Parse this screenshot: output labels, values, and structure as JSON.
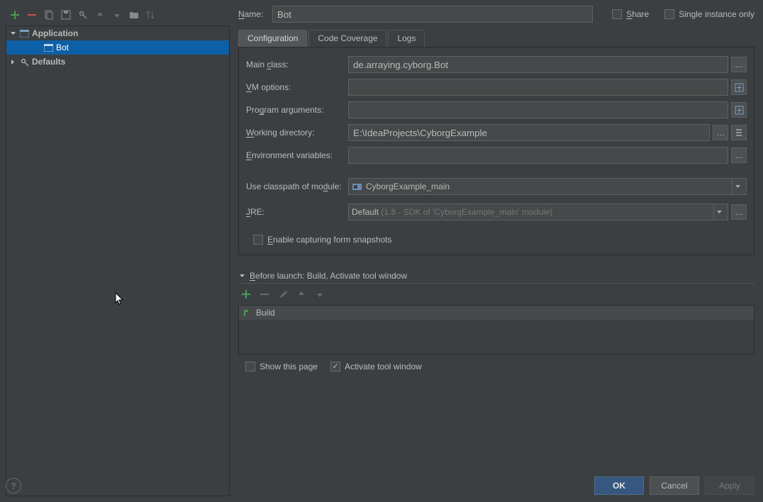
{
  "header": {
    "name_label": "Name:",
    "name_value": "Bot",
    "share_label": "Share",
    "single_instance_label": "Single instance only"
  },
  "toolbar_icons": [
    "add",
    "remove",
    "copy",
    "save",
    "settings",
    "up",
    "down",
    "folder",
    "sort"
  ],
  "tree": {
    "root": "Application",
    "child": "Bot",
    "defaults": "Defaults"
  },
  "tabs": {
    "active": "Configuration",
    "tab1": "Configuration",
    "tab2": "Code Coverage",
    "tab3": "Logs"
  },
  "form": {
    "main_class_label": "Main class:",
    "main_class_value": "de.arraying.cyborg.Bot",
    "vm_options_label": "VM options:",
    "vm_options_value": "",
    "prog_args_label": "Program arguments:",
    "prog_args_value": "",
    "working_dir_label": "Working directory:",
    "working_dir_value": "E:\\IdeaProjects\\CyborgExample",
    "env_vars_label": "Environment variables:",
    "env_vars_value": "",
    "classpath_label": "Use classpath of module:",
    "classpath_value": "CyborgExample_main",
    "jre_label": "JRE:",
    "jre_value": "Default",
    "jre_hint": "(1.8 - SDK of 'CyborgExample_main' module)",
    "enable_capture_label": "Enable capturing form snapshots"
  },
  "before_launch": {
    "header": "Before launch: Build, Activate tool window",
    "item": "Build",
    "show_page_label": "Show this page",
    "activate_window_label": "Activate tool window"
  },
  "buttons": {
    "ok": "OK",
    "cancel": "Cancel",
    "apply": "Apply"
  }
}
